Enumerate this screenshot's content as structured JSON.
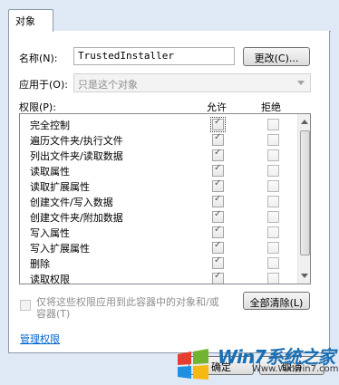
{
  "tabs": [
    {
      "label": "对象"
    }
  ],
  "name_label": "名称(N):",
  "name_value": "TrustedInstaller",
  "change_button": "更改(C)...",
  "apply_to_label": "应用于(O):",
  "apply_to_value": "只是这个对象",
  "permissions_label": "权限(P):",
  "allow_header": "允许",
  "deny_header": "拒绝",
  "permissions": [
    {
      "name": "完全控制",
      "allow": true,
      "deny": false
    },
    {
      "name": "遍历文件夹/执行文件",
      "allow": true,
      "deny": false
    },
    {
      "name": "列出文件夹/读取数据",
      "allow": true,
      "deny": false
    },
    {
      "name": "读取属性",
      "allow": true,
      "deny": false
    },
    {
      "name": "读取扩展属性",
      "allow": true,
      "deny": false
    },
    {
      "name": "创建文件/写入数据",
      "allow": true,
      "deny": false
    },
    {
      "name": "创建文件夹/附加数据",
      "allow": true,
      "deny": false
    },
    {
      "name": "写入属性",
      "allow": true,
      "deny": false
    },
    {
      "name": "写入扩展属性",
      "allow": true,
      "deny": false
    },
    {
      "name": "删除",
      "allow": true,
      "deny": false
    },
    {
      "name": "读取权限",
      "allow": true,
      "deny": false
    }
  ],
  "apply_only_text": "仅将这些权限应用到此容器中的对象和/或容器(T)",
  "clear_all_button": "全部清除(L)",
  "manage_link": "管理权限",
  "ok_button": "确定",
  "cancel_button": "取消",
  "watermark": {
    "brand": "Win7系统之家",
    "url": "Www.Winwin7.com"
  }
}
